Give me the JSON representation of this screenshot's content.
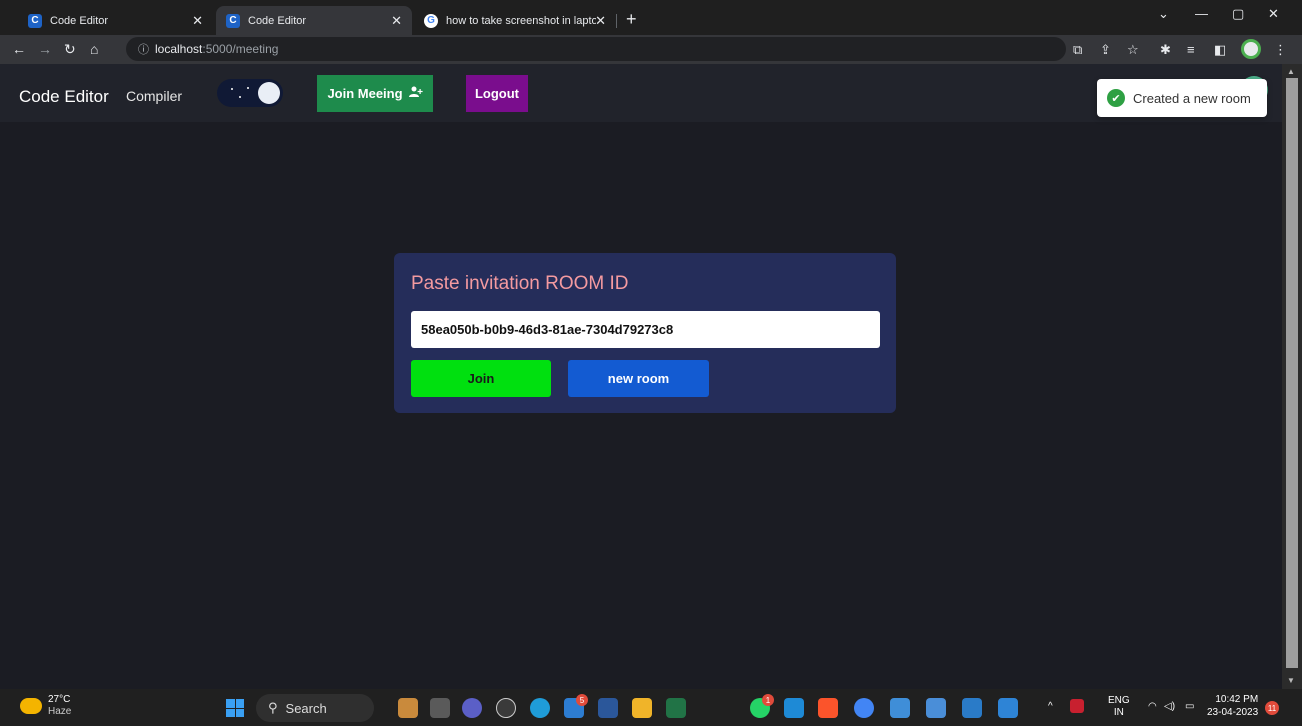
{
  "browser": {
    "tabs": [
      {
        "title": "Code Editor",
        "favicon": "C"
      },
      {
        "title": "Code Editor",
        "favicon": "C"
      },
      {
        "title": "how to take screenshot in laptop",
        "favicon": "G"
      }
    ],
    "url_host": "localhost",
    "url_path": ":5000/meeting"
  },
  "navbar": {
    "brand": "Code Editor",
    "compiler_link": "Compiler",
    "join_meeting_label": "Join Meeing",
    "logout_label": "Logout"
  },
  "toast": {
    "message": "Created a new room"
  },
  "card": {
    "title": "Paste invitation ROOM ID",
    "room_id": "58ea050b-b0b9-46d3-81ae-7304d79273c8",
    "join_label": "Join",
    "new_room_label": "new room"
  },
  "taskbar": {
    "temperature": "27°C",
    "weather": "Haze",
    "search_label": "Search",
    "language": "ENG",
    "region": "IN",
    "time": "10:42 PM",
    "date": "23-04-2023",
    "notification_count": "11",
    "mail_badge": "5",
    "whatsapp_badge": "1"
  },
  "colors": {
    "join_meeting": "#1e8b4c",
    "logout": "#7a0d8d",
    "join": "#00e00f",
    "new_room": "#135bd2",
    "card_bg": "#252d5a",
    "card_title": "#f49aa0"
  }
}
